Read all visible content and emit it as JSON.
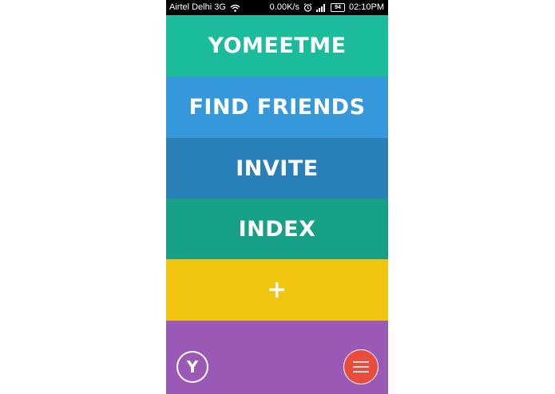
{
  "status_bar": {
    "carrier": "Airtel Delhi 3G",
    "speed": "0.00K/s",
    "battery": "94",
    "time": "02:10PM",
    "icons": [
      "wifi-icon",
      "alarm-icon",
      "signal-icon",
      "battery-icon"
    ]
  },
  "menu": {
    "items": [
      {
        "label": "YOMEETME",
        "color": "#1abc9c"
      },
      {
        "label": "FIND FRIENDS",
        "color": "#3498db"
      },
      {
        "label": "INVITE",
        "color": "#2980b9"
      },
      {
        "label": "INDEX",
        "color": "#16a085"
      },
      {
        "label": "+",
        "color": "#f1c40f"
      }
    ]
  },
  "bottom": {
    "color": "#9b59b6",
    "y_label": "Y",
    "menu_button_color": "#e74c3c",
    "menu_icon": "hamburger-icon"
  }
}
